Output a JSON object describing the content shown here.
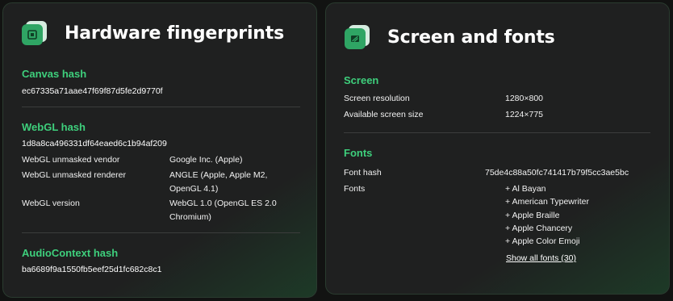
{
  "hardware": {
    "title": "Hardware fingerprints",
    "canvas": {
      "heading": "Canvas hash",
      "hash": "ec67335a71aae47f69f87d5fe2d9770f"
    },
    "webgl": {
      "heading": "WebGL hash",
      "hash": "1d8a8ca496331df64eaed6c1b94af209",
      "rows": [
        {
          "label": "WebGL unmasked vendor",
          "value": "Google Inc. (Apple)"
        },
        {
          "label": "WebGL unmasked renderer",
          "value": "ANGLE (Apple, Apple M2, OpenGL 4.1)"
        },
        {
          "label": "WebGL version",
          "value": "WebGL 1.0 (OpenGL ES 2.0 Chromium)"
        }
      ]
    },
    "audio": {
      "heading": "AudioContext hash",
      "hash": "ba6689f9a1550fb5eef25d1fc682c8c1"
    }
  },
  "screen_fonts": {
    "title": "Screen and fonts",
    "screen": {
      "heading": "Screen",
      "rows": [
        {
          "label": "Screen resolution",
          "value": "1280×800"
        },
        {
          "label": "Available screen size",
          "value": "1224×775"
        }
      ]
    },
    "fonts": {
      "heading": "Fonts",
      "hash_label": "Font hash",
      "hash_value": "75de4c88a50fc741417b79f5cc3ae5bc",
      "list_label": "Fonts",
      "items": [
        "+ Al Bayan",
        "+ American Typewriter",
        "+ Apple Braille",
        "+ Apple Chancery",
        "+ Apple Color Emoji"
      ],
      "show_all": "Show all fonts (30)"
    }
  },
  "colors": {
    "accent": "#3ecf7c",
    "card_background": "#1f2020",
    "page_background": "#121312",
    "icon_green": "#2fa564"
  },
  "icons": [
    "hardware-chip-icon",
    "screen-icon"
  ]
}
